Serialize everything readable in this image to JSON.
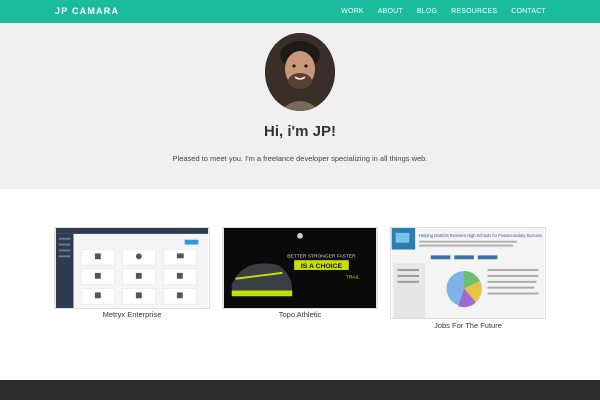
{
  "nav": {
    "brand": "JP CAMARA",
    "links": [
      "WORK",
      "ABOUT",
      "BLOG",
      "RESOURCES",
      "CONTACT"
    ]
  },
  "hero": {
    "title": "Hi, i'm JP!",
    "subtitle": "Pleased to meet you. I'm a freelance developer specializing in all things web."
  },
  "work": [
    {
      "title": "Metryx Enterprise"
    },
    {
      "title": "Topo Athletic",
      "thumb_text": [
        "BETTER STRONGER FASTER",
        "IS A CHOICE",
        "TRAIL"
      ]
    },
    {
      "title": "Jobs For The Future",
      "thumb_text": "Helping Districts Reinvent High Schools for Postsecondary Success"
    }
  ],
  "colors": {
    "accent": "#1abc9c",
    "hero_bg": "#f0f0f0",
    "footer_bg": "#2c2c2c"
  }
}
